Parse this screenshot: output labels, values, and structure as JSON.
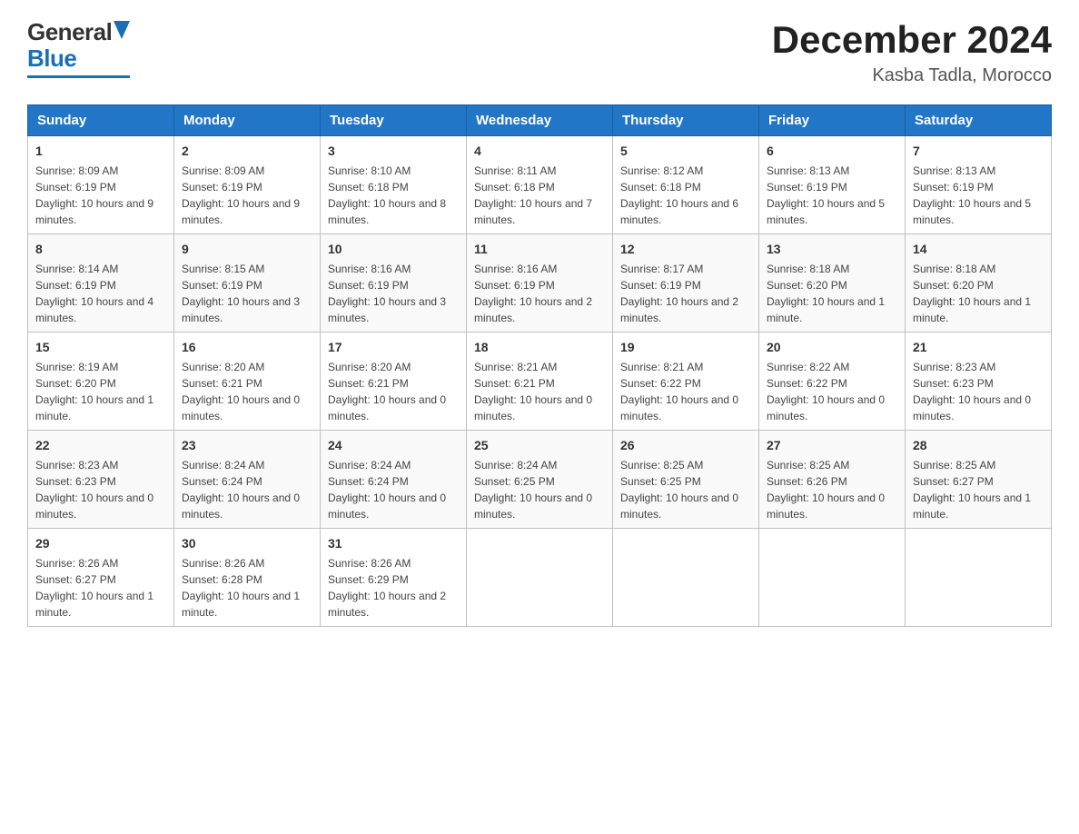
{
  "header": {
    "month_title": "December 2024",
    "location": "Kasba Tadla, Morocco",
    "logo_general": "General",
    "logo_blue": "Blue"
  },
  "days_of_week": [
    "Sunday",
    "Monday",
    "Tuesday",
    "Wednesday",
    "Thursday",
    "Friday",
    "Saturday"
  ],
  "weeks": [
    [
      {
        "day": "1",
        "sunrise": "8:09 AM",
        "sunset": "6:19 PM",
        "daylight": "10 hours and 9 minutes."
      },
      {
        "day": "2",
        "sunrise": "8:09 AM",
        "sunset": "6:19 PM",
        "daylight": "10 hours and 9 minutes."
      },
      {
        "day": "3",
        "sunrise": "8:10 AM",
        "sunset": "6:18 PM",
        "daylight": "10 hours and 8 minutes."
      },
      {
        "day": "4",
        "sunrise": "8:11 AM",
        "sunset": "6:18 PM",
        "daylight": "10 hours and 7 minutes."
      },
      {
        "day": "5",
        "sunrise": "8:12 AM",
        "sunset": "6:18 PM",
        "daylight": "10 hours and 6 minutes."
      },
      {
        "day": "6",
        "sunrise": "8:13 AM",
        "sunset": "6:19 PM",
        "daylight": "10 hours and 5 minutes."
      },
      {
        "day": "7",
        "sunrise": "8:13 AM",
        "sunset": "6:19 PM",
        "daylight": "10 hours and 5 minutes."
      }
    ],
    [
      {
        "day": "8",
        "sunrise": "8:14 AM",
        "sunset": "6:19 PM",
        "daylight": "10 hours and 4 minutes."
      },
      {
        "day": "9",
        "sunrise": "8:15 AM",
        "sunset": "6:19 PM",
        "daylight": "10 hours and 3 minutes."
      },
      {
        "day": "10",
        "sunrise": "8:16 AM",
        "sunset": "6:19 PM",
        "daylight": "10 hours and 3 minutes."
      },
      {
        "day": "11",
        "sunrise": "8:16 AM",
        "sunset": "6:19 PM",
        "daylight": "10 hours and 2 minutes."
      },
      {
        "day": "12",
        "sunrise": "8:17 AM",
        "sunset": "6:19 PM",
        "daylight": "10 hours and 2 minutes."
      },
      {
        "day": "13",
        "sunrise": "8:18 AM",
        "sunset": "6:20 PM",
        "daylight": "10 hours and 1 minute."
      },
      {
        "day": "14",
        "sunrise": "8:18 AM",
        "sunset": "6:20 PM",
        "daylight": "10 hours and 1 minute."
      }
    ],
    [
      {
        "day": "15",
        "sunrise": "8:19 AM",
        "sunset": "6:20 PM",
        "daylight": "10 hours and 1 minute."
      },
      {
        "day": "16",
        "sunrise": "8:20 AM",
        "sunset": "6:21 PM",
        "daylight": "10 hours and 0 minutes."
      },
      {
        "day": "17",
        "sunrise": "8:20 AM",
        "sunset": "6:21 PM",
        "daylight": "10 hours and 0 minutes."
      },
      {
        "day": "18",
        "sunrise": "8:21 AM",
        "sunset": "6:21 PM",
        "daylight": "10 hours and 0 minutes."
      },
      {
        "day": "19",
        "sunrise": "8:21 AM",
        "sunset": "6:22 PM",
        "daylight": "10 hours and 0 minutes."
      },
      {
        "day": "20",
        "sunrise": "8:22 AM",
        "sunset": "6:22 PM",
        "daylight": "10 hours and 0 minutes."
      },
      {
        "day": "21",
        "sunrise": "8:23 AM",
        "sunset": "6:23 PM",
        "daylight": "10 hours and 0 minutes."
      }
    ],
    [
      {
        "day": "22",
        "sunrise": "8:23 AM",
        "sunset": "6:23 PM",
        "daylight": "10 hours and 0 minutes."
      },
      {
        "day": "23",
        "sunrise": "8:24 AM",
        "sunset": "6:24 PM",
        "daylight": "10 hours and 0 minutes."
      },
      {
        "day": "24",
        "sunrise": "8:24 AM",
        "sunset": "6:24 PM",
        "daylight": "10 hours and 0 minutes."
      },
      {
        "day": "25",
        "sunrise": "8:24 AM",
        "sunset": "6:25 PM",
        "daylight": "10 hours and 0 minutes."
      },
      {
        "day": "26",
        "sunrise": "8:25 AM",
        "sunset": "6:25 PM",
        "daylight": "10 hours and 0 minutes."
      },
      {
        "day": "27",
        "sunrise": "8:25 AM",
        "sunset": "6:26 PM",
        "daylight": "10 hours and 0 minutes."
      },
      {
        "day": "28",
        "sunrise": "8:25 AM",
        "sunset": "6:27 PM",
        "daylight": "10 hours and 1 minute."
      }
    ],
    [
      {
        "day": "29",
        "sunrise": "8:26 AM",
        "sunset": "6:27 PM",
        "daylight": "10 hours and 1 minute."
      },
      {
        "day": "30",
        "sunrise": "8:26 AM",
        "sunset": "6:28 PM",
        "daylight": "10 hours and 1 minute."
      },
      {
        "day": "31",
        "sunrise": "8:26 AM",
        "sunset": "6:29 PM",
        "daylight": "10 hours and 2 minutes."
      },
      null,
      null,
      null,
      null
    ]
  ],
  "labels": {
    "sunrise": "Sunrise: ",
    "sunset": "Sunset: ",
    "daylight": "Daylight: "
  }
}
